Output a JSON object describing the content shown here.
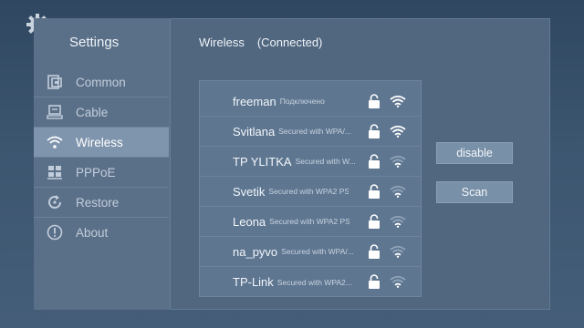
{
  "sidebar": {
    "title": "Settings",
    "items": [
      {
        "label": "Common",
        "icon": "common-icon",
        "active": false
      },
      {
        "label": "Cable",
        "icon": "cable-icon",
        "active": false
      },
      {
        "label": "Wireless",
        "icon": "wifi-icon",
        "active": true
      },
      {
        "label": "PPPoE",
        "icon": "pppoe-icon",
        "active": false
      },
      {
        "label": "Restore",
        "icon": "restore-icon",
        "active": false
      },
      {
        "label": "About",
        "icon": "info-icon",
        "active": false
      }
    ]
  },
  "main": {
    "title": "Wireless",
    "status": "(Connected)"
  },
  "networks": [
    {
      "name": "freeman",
      "security": "Подключено",
      "locked": true,
      "signal": 4
    },
    {
      "name": "Svitlana",
      "security": "Secured with WPA/...",
      "locked": true,
      "signal": 4
    },
    {
      "name": "TP YLITKA",
      "security": "Secured with W...",
      "locked": true,
      "signal": 2
    },
    {
      "name": "Svetik",
      "security": "Secured with WPA2 PS...",
      "locked": true,
      "signal": 2
    },
    {
      "name": "Leona",
      "security": "Secured with WPA2 PS...",
      "locked": true,
      "signal": 2
    },
    {
      "name": "na_pyvo",
      "security": "Secured with WPA/...",
      "locked": true,
      "signal": 2
    },
    {
      "name": "TP-Link",
      "security": "Secured with WPA2...",
      "locked": true,
      "signal": 2
    }
  ],
  "buttons": {
    "disable": "disable",
    "scan": "Scan"
  },
  "colors": {
    "background": "#3d5670",
    "panel": "#51677f",
    "active_item": "#7f95ad",
    "button": "#7890a8"
  }
}
